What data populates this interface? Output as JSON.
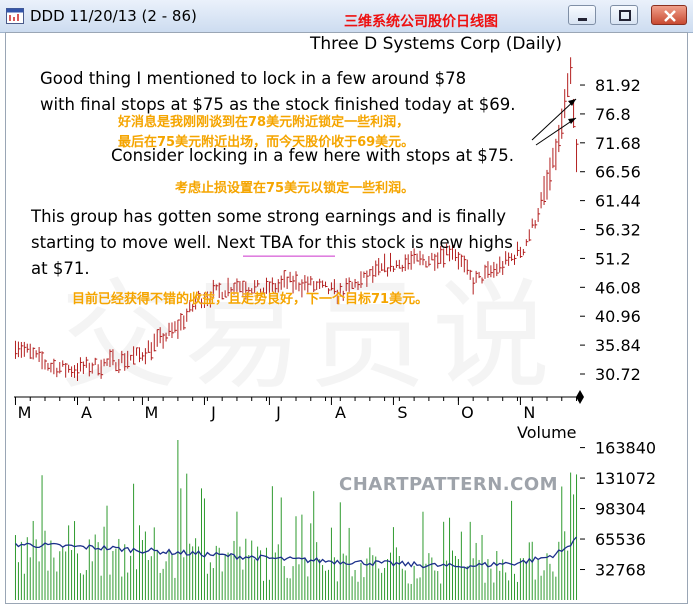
{
  "window": {
    "title": "DDD 11/20/13 (2 - 86)",
    "caption_cn": "三维系统公司股价日线图",
    "icon": "chart-app-icon",
    "buttons": [
      "minimize-icon",
      "restore-icon",
      "close-icon"
    ]
  },
  "chart_data": {
    "type": "bar",
    "title": "Three D Systems Corp (Daily)",
    "price_axis": {
      "ticks": [
        81.92,
        76.8,
        71.68,
        66.56,
        61.44,
        56.32,
        51.2,
        46.08,
        40.96,
        35.84,
        30.72
      ],
      "tick_labels": [
        "81.92",
        "76.8",
        "71.68",
        "66.56",
        "61.44",
        "56.32",
        "51.2",
        "46.08",
        "40.96",
        "35.84",
        "30.72"
      ],
      "ylim": [
        27.0,
        86.0
      ],
      "position": "right"
    },
    "volume_axis": {
      "label": "Volume",
      "ticks": [
        163840,
        131072,
        98304,
        65536,
        32768
      ],
      "tick_labels": [
        "163840",
        "131072",
        "98304",
        "65536",
        "32768"
      ],
      "ylim": [
        0,
        172000
      ]
    },
    "months": [
      "M",
      "A",
      "M",
      "J",
      "J",
      "A",
      "S",
      "O",
      "N"
    ],
    "month_positions": [
      0,
      21,
      43,
      64,
      86,
      107,
      128,
      150,
      171
    ],
    "n_days": 191,
    "price_path": [
      [
        0,
        36.0
      ],
      [
        12,
        32.0
      ],
      [
        20,
        31.5
      ],
      [
        30,
        32.5
      ],
      [
        42,
        34.0
      ],
      [
        55,
        39.0
      ],
      [
        62,
        44.0
      ],
      [
        75,
        46.5
      ],
      [
        85,
        45.5
      ],
      [
        92,
        47.0
      ],
      [
        100,
        46.5
      ],
      [
        110,
        45.0
      ],
      [
        118,
        47.5
      ],
      [
        125,
        49.5
      ],
      [
        132,
        50.5
      ],
      [
        140,
        51.0
      ],
      [
        148,
        53.0
      ],
      [
        155,
        47.0
      ],
      [
        160,
        48.5
      ],
      [
        165,
        50.0
      ],
      [
        172,
        53.0
      ],
      [
        176,
        58.0
      ],
      [
        180,
        64.0
      ],
      [
        184,
        72.0
      ],
      [
        186,
        78.0
      ],
      [
        188,
        84.0
      ],
      [
        190,
        69.0
      ]
    ],
    "volume_average_path": [
      [
        0,
        60000
      ],
      [
        30,
        56000
      ],
      [
        60,
        50000
      ],
      [
        90,
        44000
      ],
      [
        120,
        40000
      ],
      [
        150,
        36000
      ],
      [
        170,
        40000
      ],
      [
        180,
        46000
      ],
      [
        186,
        54000
      ],
      [
        190,
        68000
      ]
    ],
    "volume_spikes": [
      [
        55,
        172000
      ],
      [
        40,
        125000
      ],
      [
        63,
        120000
      ],
      [
        101,
        117000
      ],
      [
        110,
        105000
      ],
      [
        188,
        137000
      ],
      [
        185,
        122000
      ],
      [
        190,
        135000
      ],
      [
        154,
        84000
      ],
      [
        75,
        95000
      ]
    ],
    "colors": {
      "price_bars": "#b32020",
      "volume_bars": "#2e9a2e",
      "volume_average": "#1b2f8a",
      "annotation_cn": "#f5a500",
      "caption_cn": "#ee1010",
      "marker_line": "#cc33cc"
    }
  },
  "annotations": {
    "note1_line1": "Good thing I mentioned to lock in a few around $78",
    "note1_line2": "with final stops at $75 as the stock finished today at $69.",
    "note1_cn_line1": "好消息是我刚刚谈到在78美元附近锁定一些利润，",
    "note1_cn_line2": "最后在75美元附近出场，而今天股价收于69美元。",
    "note2": "Consider locking in a few here with stops at $75.",
    "note2_cn": "考虑止损设置在75美元以锁定一些利润。",
    "note3_line1": "This group has gotten some strong earnings and is finally",
    "note3_line2": "starting to move well. Next TBA for this stock is new highs",
    "note3_line3": "at $71.",
    "note3_cn": "目前已经获得不错的收益，且走势良好，下一个目标71美元。"
  },
  "watermarks": {
    "site": "CHARTPATTERN.COM",
    "cn": "交易员说"
  }
}
